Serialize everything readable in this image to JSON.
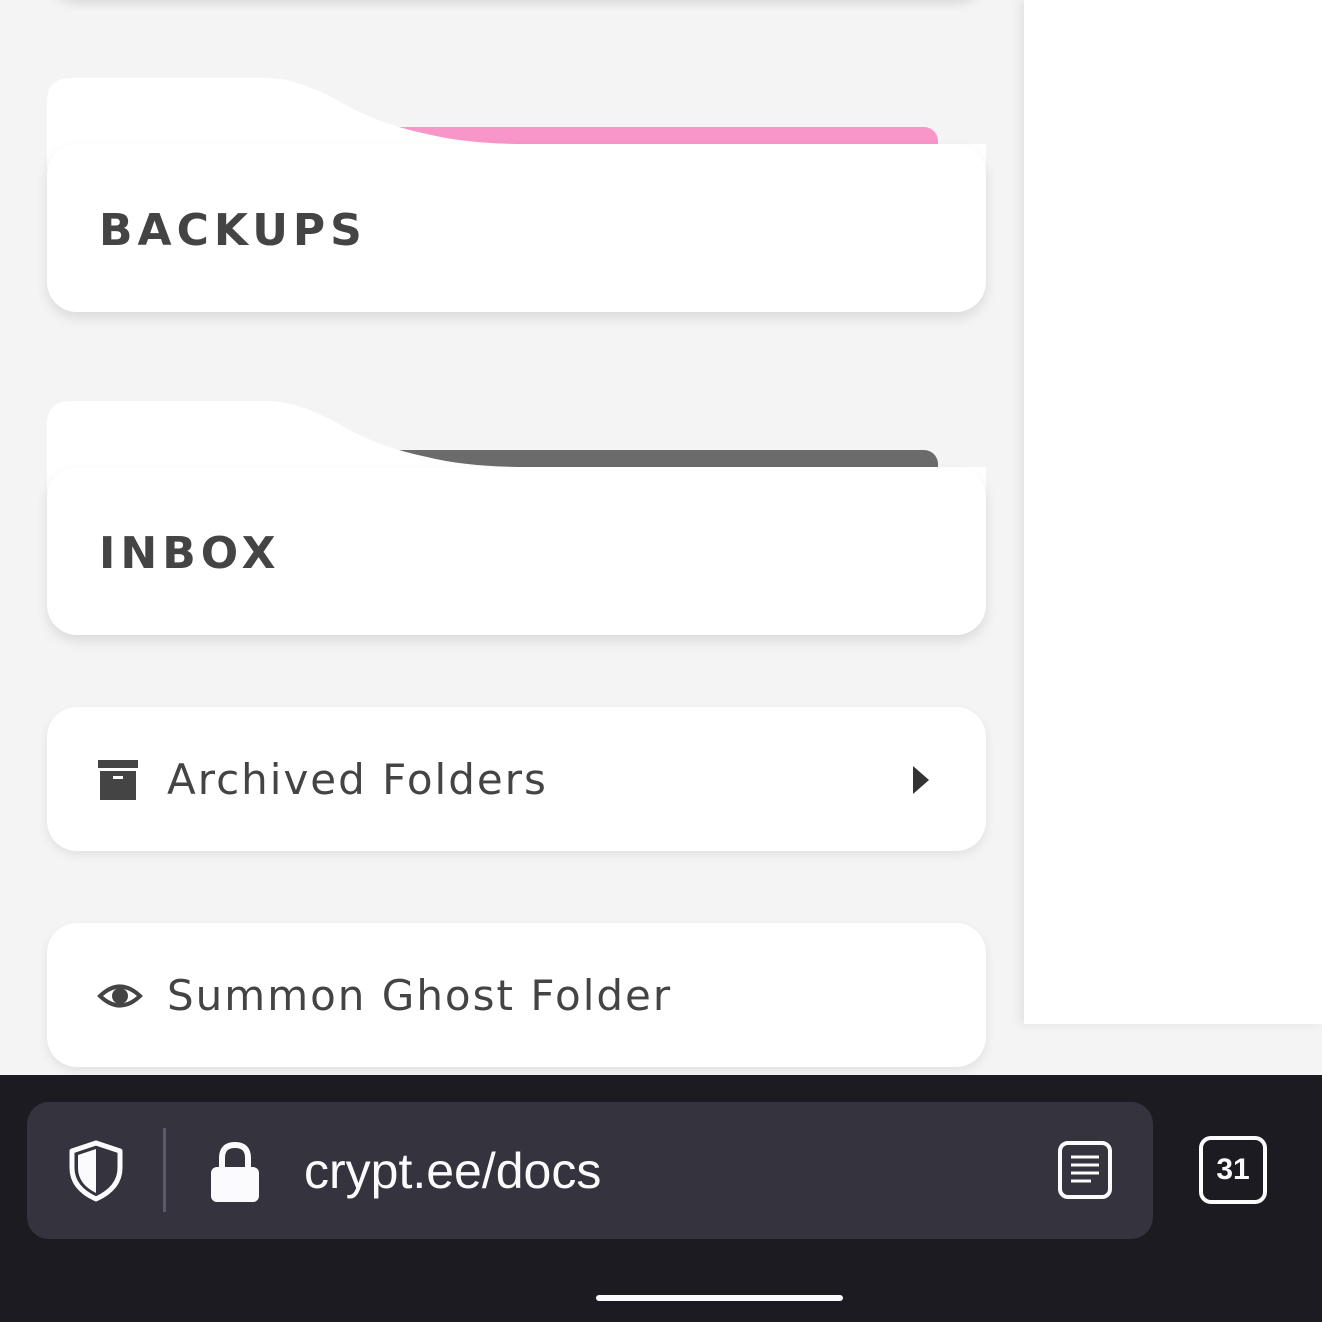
{
  "folders": [
    {
      "name": "BACKUPS",
      "color": "#f895c9"
    },
    {
      "name": "INBOX",
      "color": "#6b6b6b"
    }
  ],
  "rows": {
    "archived": {
      "label": "Archived Folders",
      "icon": "archive-box-icon",
      "chevron_icon": "chevron-right-icon"
    },
    "ghost": {
      "label": "Summon Ghost Folder",
      "icon": "eye-icon"
    }
  },
  "browser": {
    "url": "crypt.ee/docs",
    "tab_count": "31",
    "icons": [
      "shield-icon",
      "lock-icon",
      "reader-mode-icon",
      "tabs-counter-icon"
    ]
  },
  "colors": {
    "background": "#f4f4f4",
    "card": "#ffffff",
    "text": "#444444",
    "browser_bar": "#1c1b22",
    "url_box": "#34333e"
  }
}
